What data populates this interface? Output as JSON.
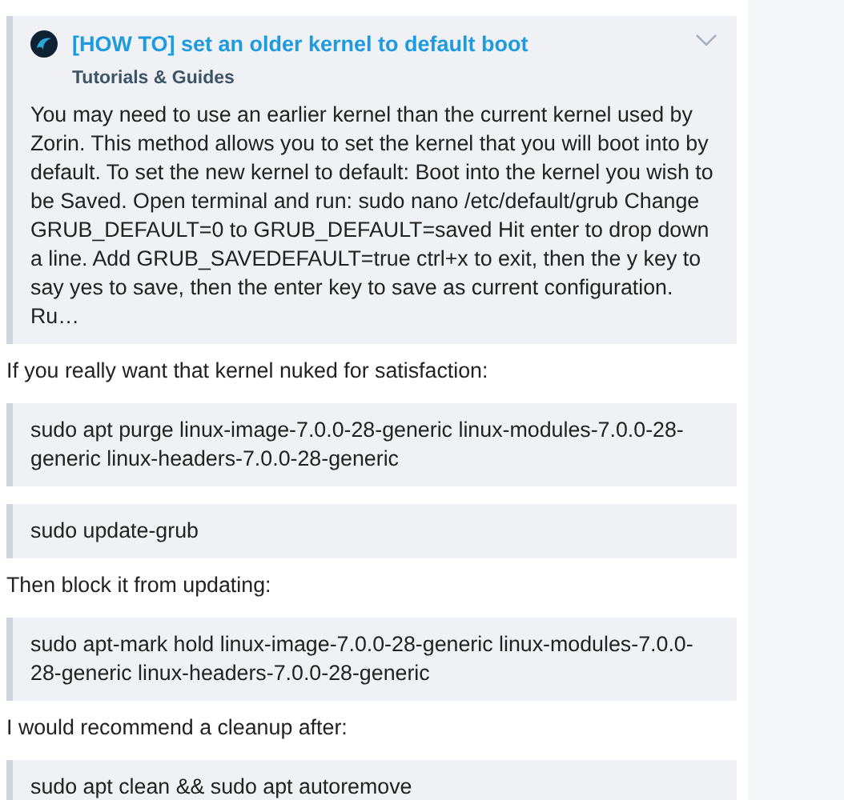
{
  "onebox": {
    "title": "[HOW TO] set an older kernel to default boot",
    "category": "Tutorials & Guides",
    "expanded": false,
    "excerpt": "You may need to use an earlier kernel than the current kernel used by Zorin. This method allows you to set the kernel that you will boot into by default. To set the new kernel to default: Boot into the kernel you wish to be Saved. Open terminal and run: sudo nano /etc/default/grub Change GRUB_DEFAULT=0 to GRUB_DEFAULT=saved Hit enter to drop down a line. Add GRUB_SAVEDEFAULT=true ctrl+x to exit, then the y key to say yes to save, then the enter key to save as current configuration. Ru…"
  },
  "blocks": [
    {
      "kind": "paragraph",
      "text": "If you really want that kernel nuked for satisfaction:"
    },
    {
      "kind": "quote",
      "text": "sudo apt purge linux-image-7.0.0-28-generic linux-modules-7.0.0-28-generic linux-headers-7.0.0-28-generic"
    },
    {
      "kind": "quote",
      "text": "sudo update-grub"
    },
    {
      "kind": "paragraph",
      "text": "Then block it from updating:"
    },
    {
      "kind": "quote",
      "text": "sudo apt-mark hold linux-image-7.0.0-28-generic linux-modules-7.0.0-28-generic linux-headers-7.0.0-28-generic"
    },
    {
      "kind": "paragraph",
      "text": "I would recommend a cleanup after:"
    },
    {
      "kind": "quote",
      "text": "sudo apt clean && sudo apt autoremove"
    }
  ]
}
